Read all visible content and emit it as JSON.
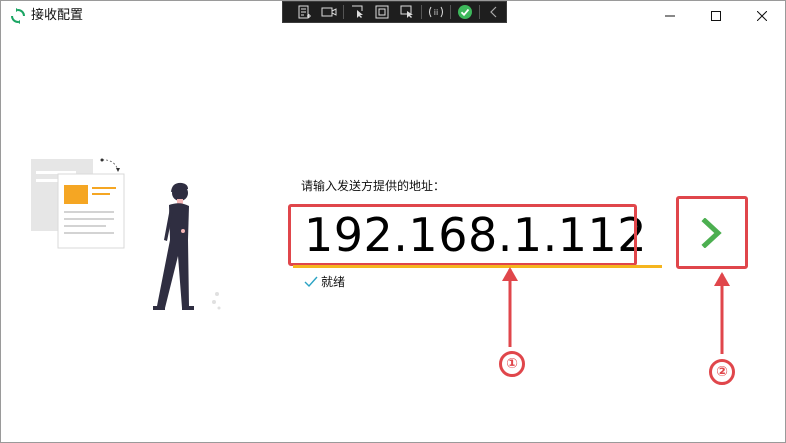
{
  "window": {
    "title": "接收配置"
  },
  "prompt": {
    "label": "请输入发送方提供的地址："
  },
  "address": {
    "value": "192.168.1.112"
  },
  "status": {
    "text": "就绪"
  },
  "annotations": {
    "badge1": "①",
    "badge2": "②"
  },
  "colors": {
    "accent": "#f5b51e",
    "annotation": "#e0464b",
    "go": "#4caf50",
    "check": "#2ba3c4"
  }
}
